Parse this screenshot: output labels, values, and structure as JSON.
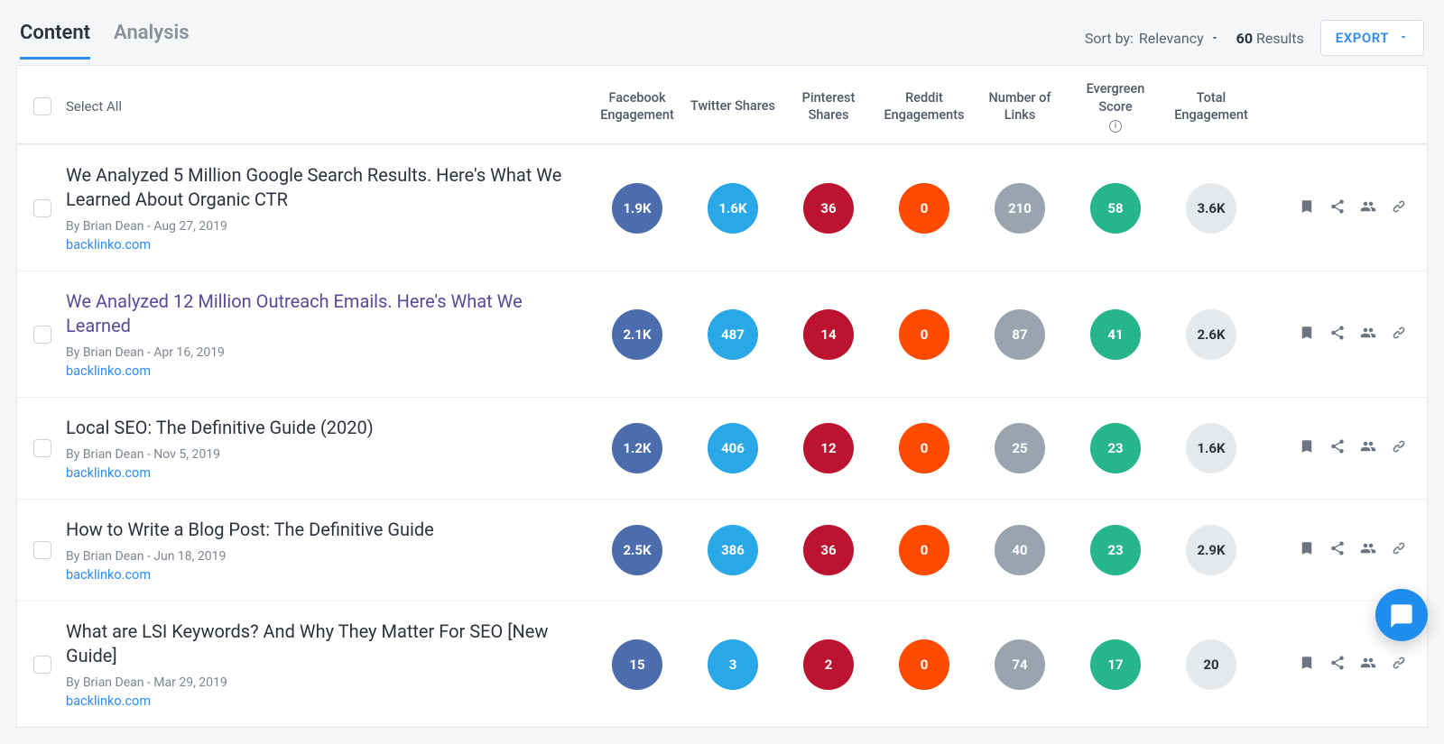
{
  "tabs": {
    "content": "Content",
    "analysis": "Analysis"
  },
  "sort": {
    "label": "Sort by:",
    "value": "Relevancy"
  },
  "results": {
    "count": "60",
    "label": "Results"
  },
  "export": "EXPORT",
  "header": {
    "selectAll": "Select All",
    "cols": {
      "fb": "Facebook Engagement",
      "tw": "Twitter Shares",
      "pin": "Pinterest Shares",
      "red": "Reddit Engagements",
      "links": "Number of Links",
      "ever": "Evergreen Score",
      "total": "Total Engagement"
    }
  },
  "rows": [
    {
      "title": "We Analyzed 5 Million Google Search Results. Here's What We Learned About Organic CTR",
      "by": "By Brian Dean - Aug 27, 2019",
      "domain": "backlinko.com",
      "fb": "1.9K",
      "tw": "1.6K",
      "pin": "36",
      "red": "0",
      "links": "210",
      "ever": "58",
      "total": "3.6K"
    },
    {
      "title": "We Analyzed 12 Million Outreach Emails. Here's What We Learned",
      "visited": true,
      "by": "By Brian Dean - Apr 16, 2019",
      "domain": "backlinko.com",
      "fb": "2.1K",
      "tw": "487",
      "pin": "14",
      "red": "0",
      "links": "87",
      "ever": "41",
      "total": "2.6K"
    },
    {
      "title": "Local SEO: The Definitive Guide (2020)",
      "by": "By Brian Dean - Nov 5, 2019",
      "domain": "backlinko.com",
      "fb": "1.2K",
      "tw": "406",
      "pin": "12",
      "red": "0",
      "links": "25",
      "ever": "23",
      "total": "1.6K"
    },
    {
      "title": "How to Write a Blog Post: The Definitive Guide",
      "by": "By Brian Dean - Jun 18, 2019",
      "domain": "backlinko.com",
      "fb": "2.5K",
      "tw": "386",
      "pin": "36",
      "red": "0",
      "links": "40",
      "ever": "23",
      "total": "2.9K"
    },
    {
      "title": "What are LSI Keywords? And Why They Matter For SEO [New Guide]",
      "by": "By Brian Dean - Mar 29, 2019",
      "domain": "backlinko.com",
      "fb": "15",
      "tw": "3",
      "pin": "2",
      "red": "0",
      "links": "74",
      "ever": "17",
      "total": "20"
    }
  ]
}
